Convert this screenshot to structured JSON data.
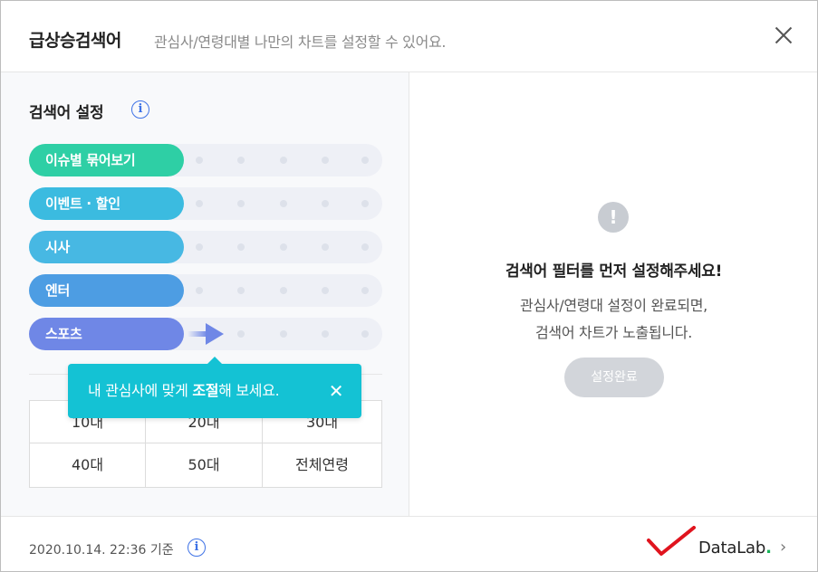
{
  "header": {
    "title": "급상승검색어",
    "subtitle": "관심사/연령대별 나만의 차트를 설정할 수 있어요."
  },
  "settings": {
    "title": "검색어 설정",
    "info_icon": "info-icon",
    "categories": [
      {
        "label": "이슈별 묶어보기",
        "color": "#2ecfa5"
      },
      {
        "label": "이벤트 · 할인",
        "color": "#3bbbe0"
      },
      {
        "label": "시사",
        "color": "#47b8e3"
      },
      {
        "label": "엔터",
        "color": "#4d9de3"
      },
      {
        "label": "스포츠",
        "color": "#6f87e6"
      }
    ],
    "ages": [
      "10대",
      "20대",
      "30대",
      "40대",
      "50대",
      "전체연령"
    ]
  },
  "tooltip": {
    "prefix": "내 관심사에 맞게 ",
    "bold": "조절",
    "suffix": "해 보세요.",
    "close": "✕"
  },
  "empty_state": {
    "icon": "!",
    "title": "검색어 필터를 먼저 설정해주세요!",
    "line1": "관심사/연령대 설정이 완료되면,",
    "line2": "검색어 차트가 노출됩니다.",
    "button": "설정완료"
  },
  "footer": {
    "timestamp": "2020.10.14. 22:36 기준",
    "brand": "DataLab",
    "brand_dot": ".",
    "chevron": "›"
  },
  "colors": {
    "accent_blue": "#3e72e6",
    "tooltip_bg": "#14c2d4",
    "logo_red": "#e0141e",
    "logo_green": "#18b45a"
  }
}
